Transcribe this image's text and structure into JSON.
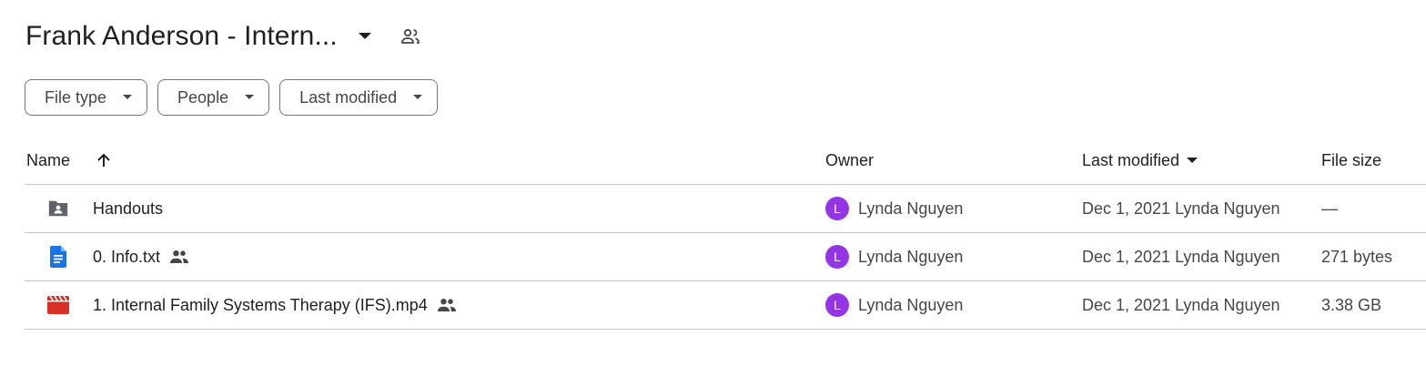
{
  "header": {
    "title": "Frank Anderson - Intern...",
    "caret_icon": "arrow-drop-down-icon",
    "people_icon": "people-icon"
  },
  "filters": [
    {
      "label": "File type",
      "icon": "arrow-drop-down-icon"
    },
    {
      "label": "People",
      "icon": "arrow-drop-down-icon"
    },
    {
      "label": "Last modified",
      "icon": "arrow-drop-down-icon"
    }
  ],
  "columns": {
    "name": "Name",
    "owner": "Owner",
    "last_modified": "Last modified",
    "file_size": "File size",
    "name_sort_icon": "arrow-up-icon",
    "modified_sort_icon": "arrow-drop-down-icon"
  },
  "rows": [
    {
      "name": "Handouts",
      "icon": "shared-folder-icon",
      "shared": false,
      "owner": "Lynda Nguyen",
      "owner_initial": "L",
      "modified": "Dec 1, 2021 Lynda Nguyen",
      "size": "—"
    },
    {
      "name": "0. Info.txt",
      "icon": "google-docs-icon",
      "shared": true,
      "owner": "Lynda Nguyen",
      "owner_initial": "L",
      "modified": "Dec 1, 2021 Lynda Nguyen",
      "size": "271 bytes"
    },
    {
      "name": "1. Internal Family Systems Therapy (IFS).mp4",
      "icon": "video-file-icon",
      "shared": true,
      "owner": "Lynda Nguyen",
      "owner_initial": "L",
      "modified": "Dec 1, 2021 Lynda Nguyen",
      "size": "3.38 GB"
    }
  ],
  "colors": {
    "avatar": "#9334e6",
    "folder_icon": "#5f6368",
    "doc_icon": "#1a73e8",
    "video_icon": "#d93025",
    "divider": "#c7c7c7"
  }
}
